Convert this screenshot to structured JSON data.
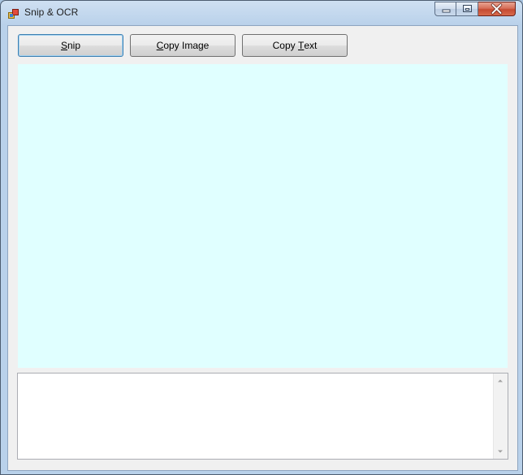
{
  "window": {
    "title": "Snip & OCR"
  },
  "toolbar": {
    "snip": {
      "prefix": "",
      "accel": "S",
      "rest": "nip"
    },
    "copy_image": {
      "prefix": "",
      "accel": "C",
      "rest": "opy Image"
    },
    "copy_text": {
      "prefix": "Copy ",
      "accel": "T",
      "rest": "ext"
    }
  },
  "panel": {
    "background_color": "#e0ffff"
  },
  "ocr_text": {
    "value": ""
  },
  "icons": [
    "app-icon",
    "minimize-icon",
    "maximize-icon",
    "close-icon",
    "scroll-up-arrow-icon",
    "scroll-down-arrow-icon"
  ]
}
